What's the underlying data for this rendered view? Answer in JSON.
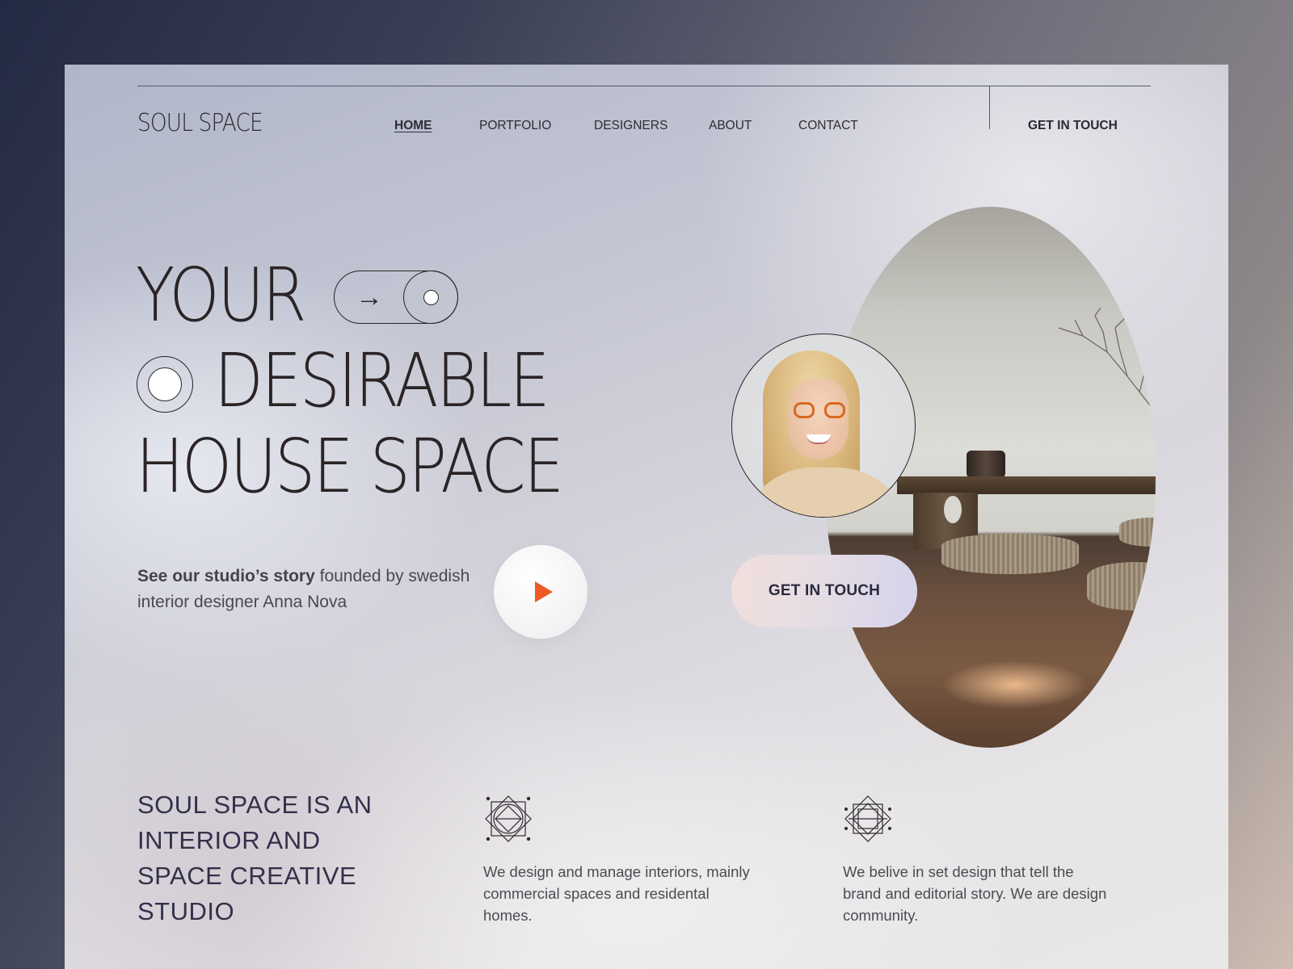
{
  "brand": {
    "logo": "SOUL SPACE"
  },
  "nav": {
    "items": [
      {
        "label": "HOME",
        "active": true
      },
      {
        "label": "PORTFOLIO",
        "active": false
      },
      {
        "label": "DESIGNERS",
        "active": false
      },
      {
        "label": "ABOUT",
        "active": false
      },
      {
        "label": "CONTACT",
        "active": false
      }
    ],
    "cta_label": "GET IN TOUCH"
  },
  "hero": {
    "headline_lines": [
      "YOUR",
      "DESIRABLE",
      "HOUSE SPACE"
    ],
    "toggle_icon": "arrow-right-toggle-icon",
    "story_bold": "See our studio’s story",
    "story_rest": " founded by swedish interior designer Anna Nova",
    "play_icon": "play-icon",
    "cta_label": "GET IN TOUCH"
  },
  "about": {
    "title": "SOUL SPACE IS AN INTERIOR AND SPACE CREATIVE STUDIO",
    "features": [
      {
        "icon": "geometric-diamond-circle-icon",
        "text": "We design and manage interiors, mainly commercial spaces and residental homes."
      },
      {
        "icon": "geometric-octagram-icon",
        "text": "We belive in set design that tell the brand and  editorial story. We are design community."
      }
    ]
  },
  "colors": {
    "accent": "#ee5a24",
    "text_dark": "#2a2426",
    "heading_navy": "#33304a"
  }
}
